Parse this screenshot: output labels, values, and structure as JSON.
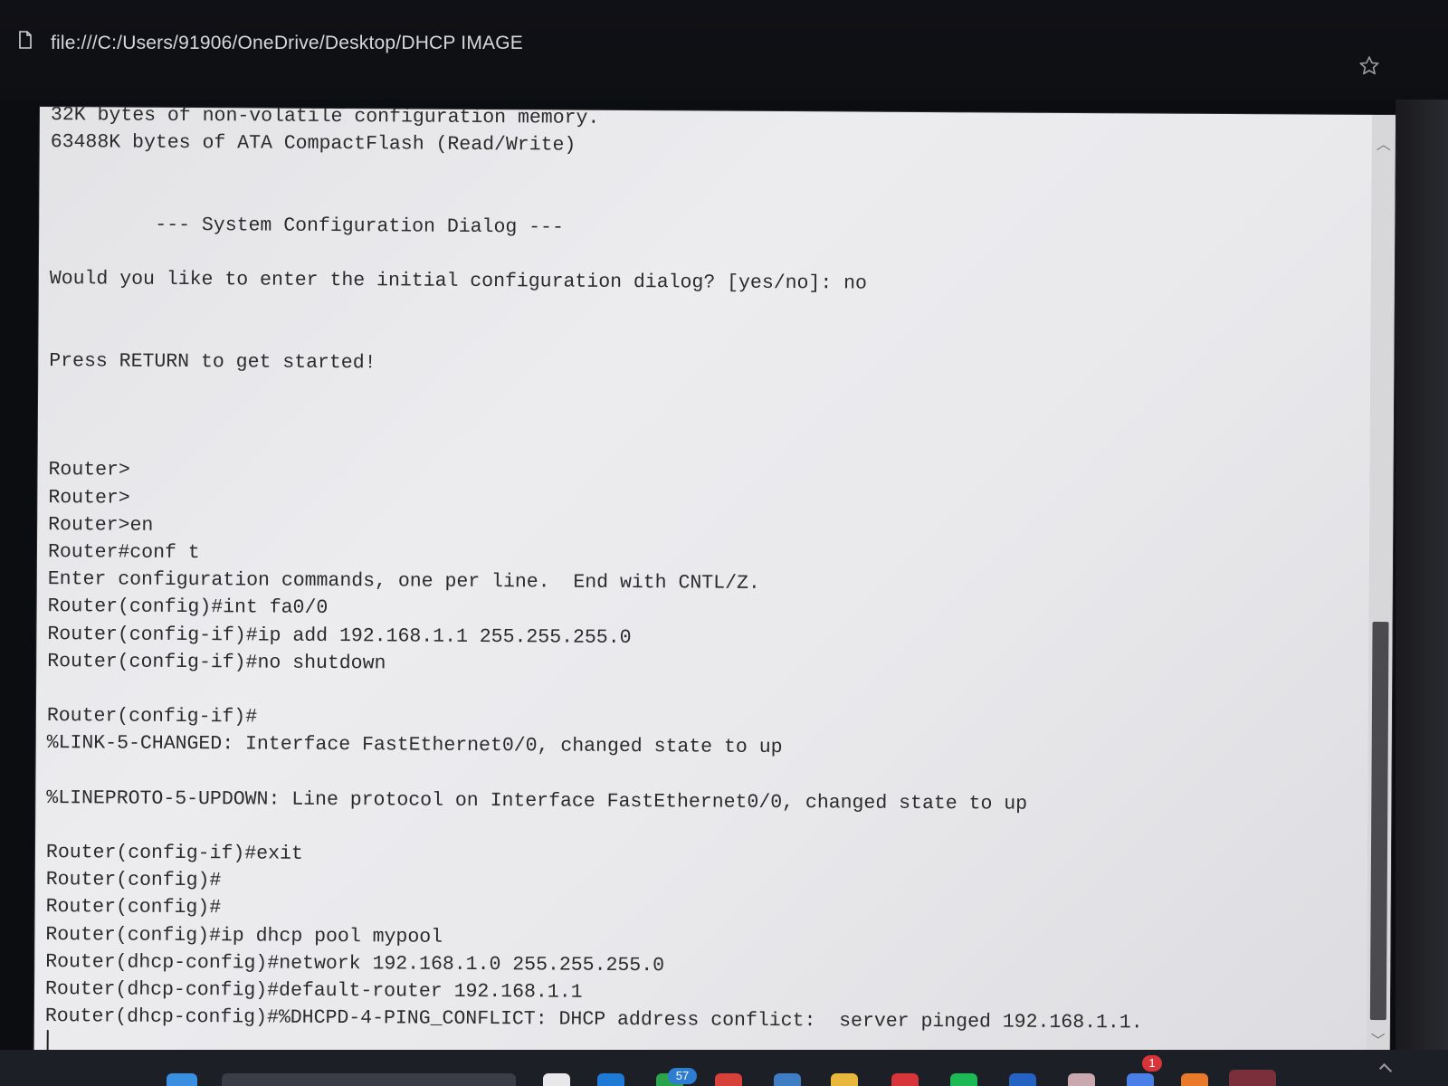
{
  "browser": {
    "url": "file:///C:/Users/91906/OneDrive/Desktop/DHCP IMAGE"
  },
  "terminal": {
    "lines": [
      "32K bytes of non-volatile configuration memory.",
      "63488K bytes of ATA CompactFlash (Read/Write)",
      "",
      "",
      "         --- System Configuration Dialog ---",
      "",
      "Would you like to enter the initial configuration dialog? [yes/no]: no",
      "",
      "",
      "Press RETURN to get started!",
      "",
      "",
      "",
      "Router>",
      "Router>",
      "Router>en",
      "Router#conf t",
      "Enter configuration commands, one per line.  End with CNTL/Z.",
      "Router(config)#int fa0/0",
      "Router(config-if)#ip add 192.168.1.1 255.255.255.0",
      "Router(config-if)#no shutdown",
      "",
      "Router(config-if)#",
      "%LINK-5-CHANGED: Interface FastEthernet0/0, changed state to up",
      "",
      "%LINEPROTO-5-UPDOWN: Line protocol on Interface FastEthernet0/0, changed state to up",
      "",
      "Router(config-if)#exit",
      "Router(config)#",
      "Router(config)#",
      "Router(config)#ip dhcp pool mypool",
      "Router(dhcp-config)#network 192.168.1.0 255.255.255.0",
      "Router(dhcp-config)#default-router 192.168.1.1",
      "Router(dhcp-config)#%DHCPD-4-PING_CONFLICT: DHCP address conflict:  server pinged 192.168.1.1."
    ]
  },
  "taskbar": {
    "badge_count": "57",
    "notification_count": "1"
  },
  "icons": {
    "file": "file-icon",
    "bookmark": "star-icon",
    "scroll_up": "chevron-up-icon",
    "scroll_down": "chevron-down-icon"
  },
  "colors": {
    "terminal_bg": "#e6e6e9",
    "terminal_text": "#2b2b2b",
    "chrome_bg": "#0e0f13",
    "scroll_thumb": "#4b4b4f",
    "taskbar_bg": "#1d1f27"
  }
}
